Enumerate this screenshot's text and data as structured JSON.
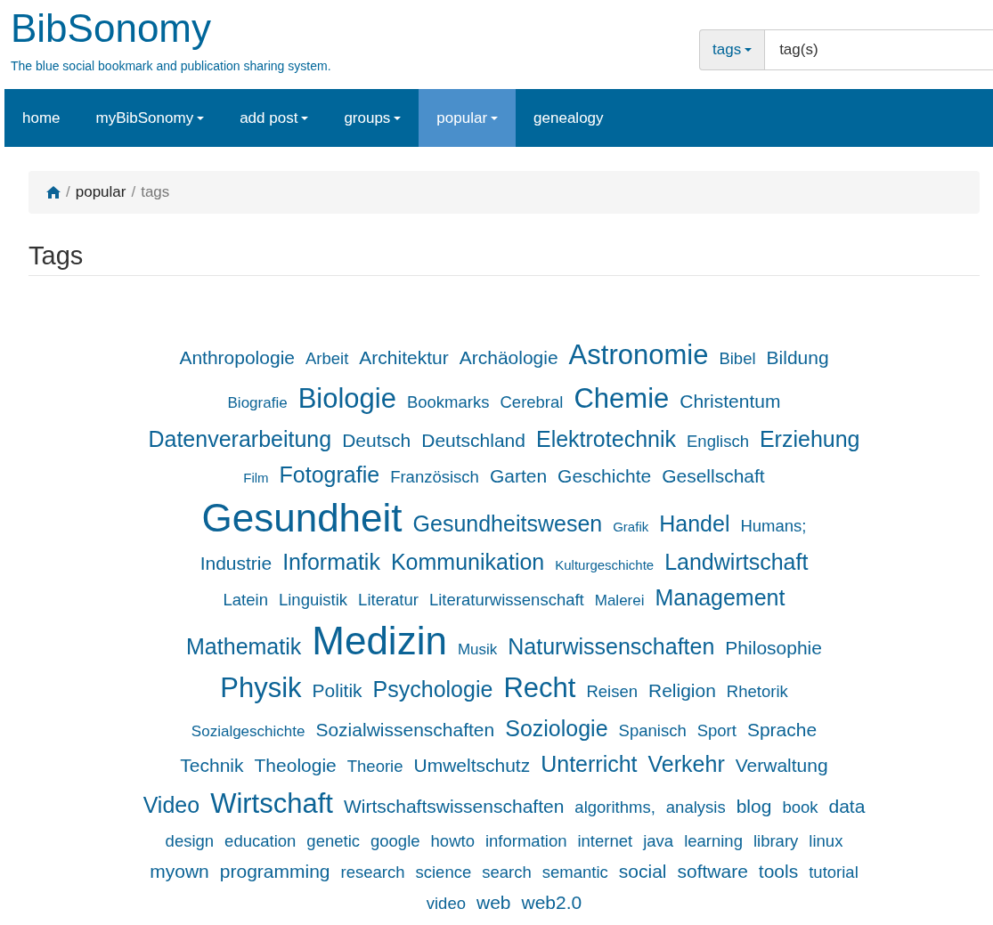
{
  "header": {
    "title": "BibSonomy",
    "tagline": "The blue social bookmark and publication sharing system."
  },
  "search": {
    "scope": "tags",
    "placeholder": "tag(s)"
  },
  "nav": [
    {
      "label": "home",
      "dropdown": false,
      "selected": false
    },
    {
      "label": "myBibSonomy",
      "dropdown": true,
      "selected": false
    },
    {
      "label": "add post",
      "dropdown": true,
      "selected": false
    },
    {
      "label": "groups",
      "dropdown": true,
      "selected": false
    },
    {
      "label": "popular",
      "dropdown": true,
      "selected": true
    },
    {
      "label": "genealogy",
      "dropdown": false,
      "selected": false
    }
  ],
  "breadcrumb": {
    "separator": "/",
    "items": [
      {
        "kind": "home"
      },
      {
        "kind": "link",
        "label": "popular"
      },
      {
        "kind": "current",
        "label": "tags"
      }
    ]
  },
  "heading": "Tags",
  "tag_cloud": {
    "lines": [
      [
        {
          "label": "Anthropologie",
          "kind": "sizable"
        },
        {
          "label": "Arbeit",
          "kind": "medium"
        },
        {
          "label": "Architektur",
          "kind": "sizable"
        },
        {
          "label": "Archäologie",
          "kind": "sizable"
        },
        {
          "label": "Astronomie",
          "kind": "huge"
        },
        {
          "label": "Bibel",
          "kind": "medium"
        },
        {
          "label": "Bildung",
          "kind": "sizable"
        }
      ],
      [
        {
          "label": "Biografie",
          "kind": "small"
        },
        {
          "label": "Biologie",
          "kind": "huge"
        },
        {
          "label": "Bookmarks",
          "kind": "medium"
        },
        {
          "label": "Cerebral",
          "kind": "medium"
        },
        {
          "label": "Chemie",
          "kind": "huge"
        },
        {
          "label": "Christentum",
          "kind": "sizable"
        }
      ],
      [
        {
          "label": "Datenverarbeitung",
          "kind": "large"
        },
        {
          "label": "Deutsch",
          "kind": "sizable"
        },
        {
          "label": "Deutschland",
          "kind": "sizable"
        },
        {
          "label": "Elektrotechnik",
          "kind": "large"
        },
        {
          "label": "Englisch",
          "kind": "medium"
        },
        {
          "label": "Erziehung",
          "kind": "large"
        }
      ],
      [
        {
          "label": "Film",
          "kind": "tiny"
        },
        {
          "label": "Fotografie",
          "kind": "large"
        },
        {
          "label": "Französisch",
          "kind": "medium"
        },
        {
          "label": "Garten",
          "kind": "sizable"
        },
        {
          "label": "Geschichte",
          "kind": "sizable"
        },
        {
          "label": "Gesellschaft",
          "kind": "sizable"
        }
      ],
      [
        {
          "label": "Gesundheit",
          "kind": "giant"
        },
        {
          "label": "Gesundheitswesen",
          "kind": "large"
        },
        {
          "label": "Grafik",
          "kind": "tiny"
        },
        {
          "label": "Handel",
          "kind": "large"
        },
        {
          "label": "Humans;",
          "kind": "medium"
        }
      ],
      [
        {
          "label": "Industrie",
          "kind": "sizable"
        },
        {
          "label": "Informatik",
          "kind": "large"
        },
        {
          "label": "Kommunikation",
          "kind": "large"
        },
        {
          "label": "Kulturgeschichte",
          "kind": "tiny"
        },
        {
          "label": "Landwirtschaft",
          "kind": "large"
        }
      ],
      [
        {
          "label": "Latein",
          "kind": "medium"
        },
        {
          "label": "Linguistik",
          "kind": "medium"
        },
        {
          "label": "Literatur",
          "kind": "medium"
        },
        {
          "label": "Literaturwissenschaft",
          "kind": "medium"
        },
        {
          "label": "Malerei",
          "kind": "small"
        },
        {
          "label": "Management",
          "kind": "large"
        }
      ],
      [
        {
          "label": "Mathematik",
          "kind": "large"
        },
        {
          "label": "Medizin",
          "kind": "giant"
        },
        {
          "label": "Musik",
          "kind": "small"
        },
        {
          "label": "Naturwissenschaften",
          "kind": "large"
        },
        {
          "label": "Philosophie",
          "kind": "sizable"
        }
      ],
      [
        {
          "label": "Physik",
          "kind": "huge"
        },
        {
          "label": "Politik",
          "kind": "sizable"
        },
        {
          "label": "Psychologie",
          "kind": "large"
        },
        {
          "label": "Recht",
          "kind": "huge"
        },
        {
          "label": "Reisen",
          "kind": "medium"
        },
        {
          "label": "Religion",
          "kind": "sizable"
        },
        {
          "label": "Rhetorik",
          "kind": "medium"
        }
      ],
      [
        {
          "label": "Sozialgeschichte",
          "kind": "small"
        },
        {
          "label": "Sozialwissenschaften",
          "kind": "sizable"
        },
        {
          "label": "Soziologie",
          "kind": "large"
        },
        {
          "label": "Spanisch",
          "kind": "medium"
        },
        {
          "label": "Sport",
          "kind": "medium"
        },
        {
          "label": "Sprache",
          "kind": "sizable"
        }
      ],
      [
        {
          "label": "Technik",
          "kind": "sizable"
        },
        {
          "label": "Theologie",
          "kind": "sizable"
        },
        {
          "label": "Theorie",
          "kind": "medium"
        },
        {
          "label": "Umweltschutz",
          "kind": "sizable"
        },
        {
          "label": "Unterricht",
          "kind": "large"
        },
        {
          "label": "Verkehr",
          "kind": "large"
        },
        {
          "label": "Verwaltung",
          "kind": "sizable"
        }
      ],
      [
        {
          "label": "Video",
          "kind": "large"
        },
        {
          "label": "Wirtschaft",
          "kind": "huge"
        },
        {
          "label": "Wirtschaftswissenschaften",
          "kind": "sizable"
        },
        {
          "label": "algorithms,",
          "kind": "medium"
        },
        {
          "label": "analysis",
          "kind": "medium"
        },
        {
          "label": "blog",
          "kind": "sizable"
        },
        {
          "label": "book",
          "kind": "medium"
        },
        {
          "label": "data",
          "kind": "sizable"
        }
      ],
      [
        {
          "label": "design",
          "kind": "medium"
        },
        {
          "label": "education",
          "kind": "medium"
        },
        {
          "label": "genetic",
          "kind": "medium"
        },
        {
          "label": "google",
          "kind": "medium"
        },
        {
          "label": "howto",
          "kind": "medium"
        },
        {
          "label": "information",
          "kind": "medium"
        },
        {
          "label": "internet",
          "kind": "medium"
        },
        {
          "label": "java",
          "kind": "medium"
        },
        {
          "label": "learning",
          "kind": "medium"
        },
        {
          "label": "library",
          "kind": "medium"
        },
        {
          "label": "linux",
          "kind": "medium"
        }
      ],
      [
        {
          "label": "myown",
          "kind": "sizable"
        },
        {
          "label": "programming",
          "kind": "sizable"
        },
        {
          "label": "research",
          "kind": "medium"
        },
        {
          "label": "science",
          "kind": "medium"
        },
        {
          "label": "search",
          "kind": "medium"
        },
        {
          "label": "semantic",
          "kind": "medium"
        },
        {
          "label": "social",
          "kind": "sizable"
        },
        {
          "label": "software",
          "kind": "sizable"
        },
        {
          "label": "tools",
          "kind": "sizable"
        },
        {
          "label": "tutorial",
          "kind": "medium"
        }
      ],
      [
        {
          "label": "video",
          "kind": "medium"
        },
        {
          "label": "web",
          "kind": "sizable"
        },
        {
          "label": "web2.0",
          "kind": "sizable"
        }
      ]
    ]
  }
}
